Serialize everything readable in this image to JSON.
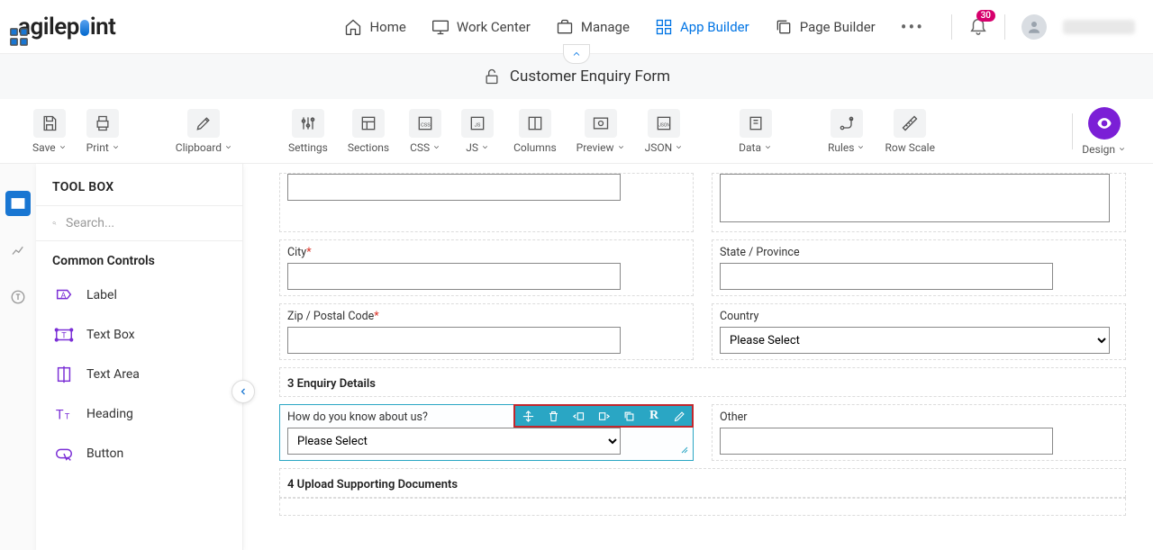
{
  "brand": "agilepoint",
  "nav": {
    "home": "Home",
    "work_center": "Work Center",
    "manage": "Manage",
    "app_builder": "App Builder",
    "page_builder": "Page Builder"
  },
  "notifications": "30",
  "form_title": "Customer Enquiry Form",
  "toolbar": {
    "save": "Save",
    "print": "Print",
    "clipboard": "Clipboard",
    "settings": "Settings",
    "sections": "Sections",
    "css": "CSS",
    "js": "JS",
    "columns": "Columns",
    "preview": "Preview",
    "json": "JSON",
    "data": "Data",
    "rules": "Rules",
    "row_scale": "Row Scale",
    "design": "Design"
  },
  "toolbox": {
    "title": "TOOL BOX",
    "search_placeholder": "Search...",
    "common": "Common Controls",
    "items": {
      "label": "Label",
      "textbox": "Text Box",
      "textarea": "Text Area",
      "heading": "Heading",
      "button": "Button"
    }
  },
  "fields": {
    "city": "City",
    "state": "State / Province",
    "zip": "Zip / Postal Code",
    "country": "Country",
    "country_value": "Please Select",
    "section3": "3 Enquiry Details",
    "how_know": "How do you know about us?",
    "how_know_value": "Please Select",
    "other": "Other",
    "section4": "4 Upload Supporting Documents"
  }
}
